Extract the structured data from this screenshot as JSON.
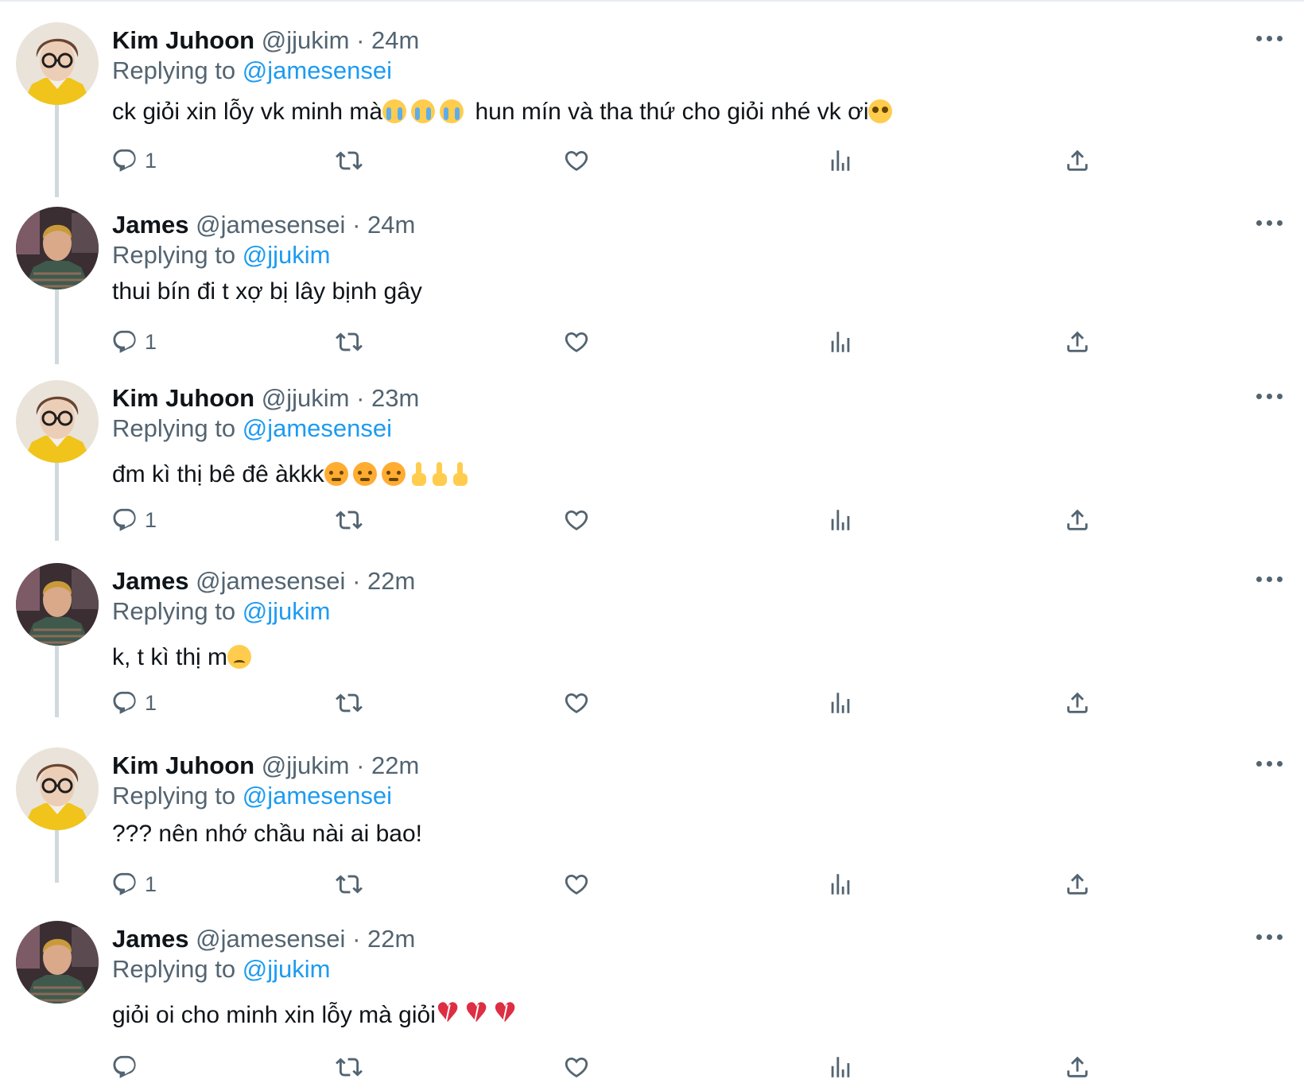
{
  "tweets": [
    {
      "name": "Kim Juhoon",
      "handle": "@jjukim",
      "time": "24m",
      "reply_prefix": "Replying to",
      "reply_to": "@jamesensei",
      "text_parts": [
        "ck giỏi xin lỗy vk minh mà",
        "hun mín và tha thứ cho giỏi nhé vk ơi"
      ],
      "emojis": [
        "loudly-crying-face",
        "loudly-crying-face",
        "loudly-crying-face",
        "pleading-face"
      ],
      "reply_count": "1",
      "avatar": "kim"
    },
    {
      "name": "James",
      "handle": "@jamesensei",
      "time": "24m",
      "reply_prefix": "Replying to",
      "reply_to": "@jjukim",
      "text_parts": [
        "thui bín đi t xợ bị lây bịnh gây"
      ],
      "emojis": [],
      "reply_count": "1",
      "avatar": "james"
    },
    {
      "name": "Kim Juhoon",
      "handle": "@jjukim",
      "time": "23m",
      "reply_prefix": "Replying to",
      "reply_to": "@jamesensei",
      "text_parts": [
        "đm kì thị bê đê àkkk"
      ],
      "emojis": [
        "angry-face",
        "angry-face",
        "angry-face",
        "middle-finger",
        "middle-finger",
        "middle-finger"
      ],
      "reply_count": "1",
      "avatar": "kim"
    },
    {
      "name": "James",
      "handle": "@jamesensei",
      "time": "22m",
      "reply_prefix": "Replying to",
      "reply_to": "@jjukim",
      "text_parts": [
        "k, t kì thị m"
      ],
      "emojis": [
        "persevering-face"
      ],
      "reply_count": "1",
      "avatar": "james"
    },
    {
      "name": "Kim Juhoon",
      "handle": "@jjukim",
      "time": "22m",
      "reply_prefix": "Replying to",
      "reply_to": "@jamesensei",
      "text_parts": [
        "??? nên nhớ chầu nài ai bao!"
      ],
      "emojis": [],
      "reply_count": "1",
      "avatar": "kim"
    },
    {
      "name": "James",
      "handle": "@jamesensei",
      "time": "22m",
      "reply_prefix": "Replying to",
      "reply_to": "@jjukim",
      "text_parts": [
        "giỏi oi cho minh xin lỗy mà giỏi"
      ],
      "emojis": [
        "broken-heart",
        "broken-heart",
        "broken-heart"
      ],
      "reply_count": "",
      "avatar": "james"
    }
  ],
  "separator": "·",
  "icons": {
    "reply": "reply-icon",
    "retweet": "retweet-icon",
    "like": "like-icon",
    "views": "views-icon",
    "share": "share-icon",
    "more": "more-icon"
  },
  "colors": {
    "link": "#1d9bf0",
    "secondary": "#536471",
    "primary": "#0f1419",
    "thread_line": "#cfd9de"
  }
}
